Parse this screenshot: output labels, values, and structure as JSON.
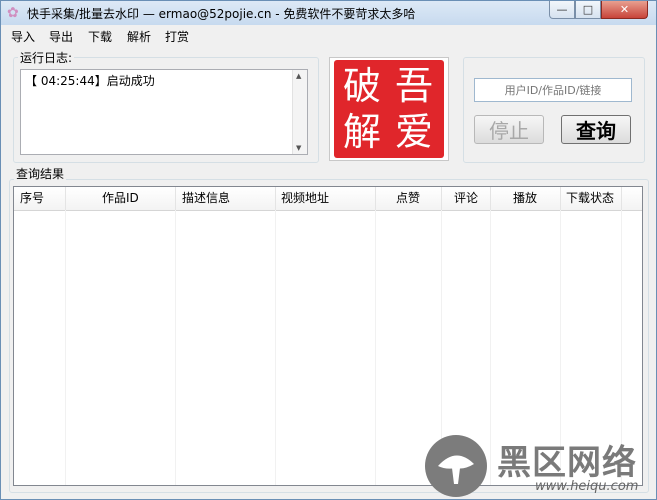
{
  "window": {
    "title": "快手采集/批量去水印 — ermao@52pojie.cn - 免费软件不要苛求太多哈",
    "controls": {
      "minimize": "—",
      "maximize": "□",
      "close": "✕"
    }
  },
  "menu": [
    "导入",
    "导出",
    "下载",
    "解析",
    "打赏"
  ],
  "log": {
    "label": "运行日志:",
    "lines": [
      {
        "time": "04:25:44",
        "text": "【 04:25:44】启动成功"
      }
    ]
  },
  "logo": {
    "chars": [
      "吾",
      "爱",
      "破",
      "解"
    ]
  },
  "search": {
    "placeholder": "用户ID/作品ID/链接"
  },
  "buttons": {
    "stop": "停止",
    "query": "查询"
  },
  "results": {
    "label": "查询结果",
    "columns": [
      "序号",
      "作品ID",
      "描述信息",
      "视频地址",
      "点赞",
      "评论",
      "播放",
      "下载状态"
    ]
  },
  "watermark": {
    "cn": "黑区网络",
    "en": "www.heiqu.com"
  },
  "colors": {
    "seal_red": "#e0262b",
    "border_blue": "#6a8fb5"
  }
}
